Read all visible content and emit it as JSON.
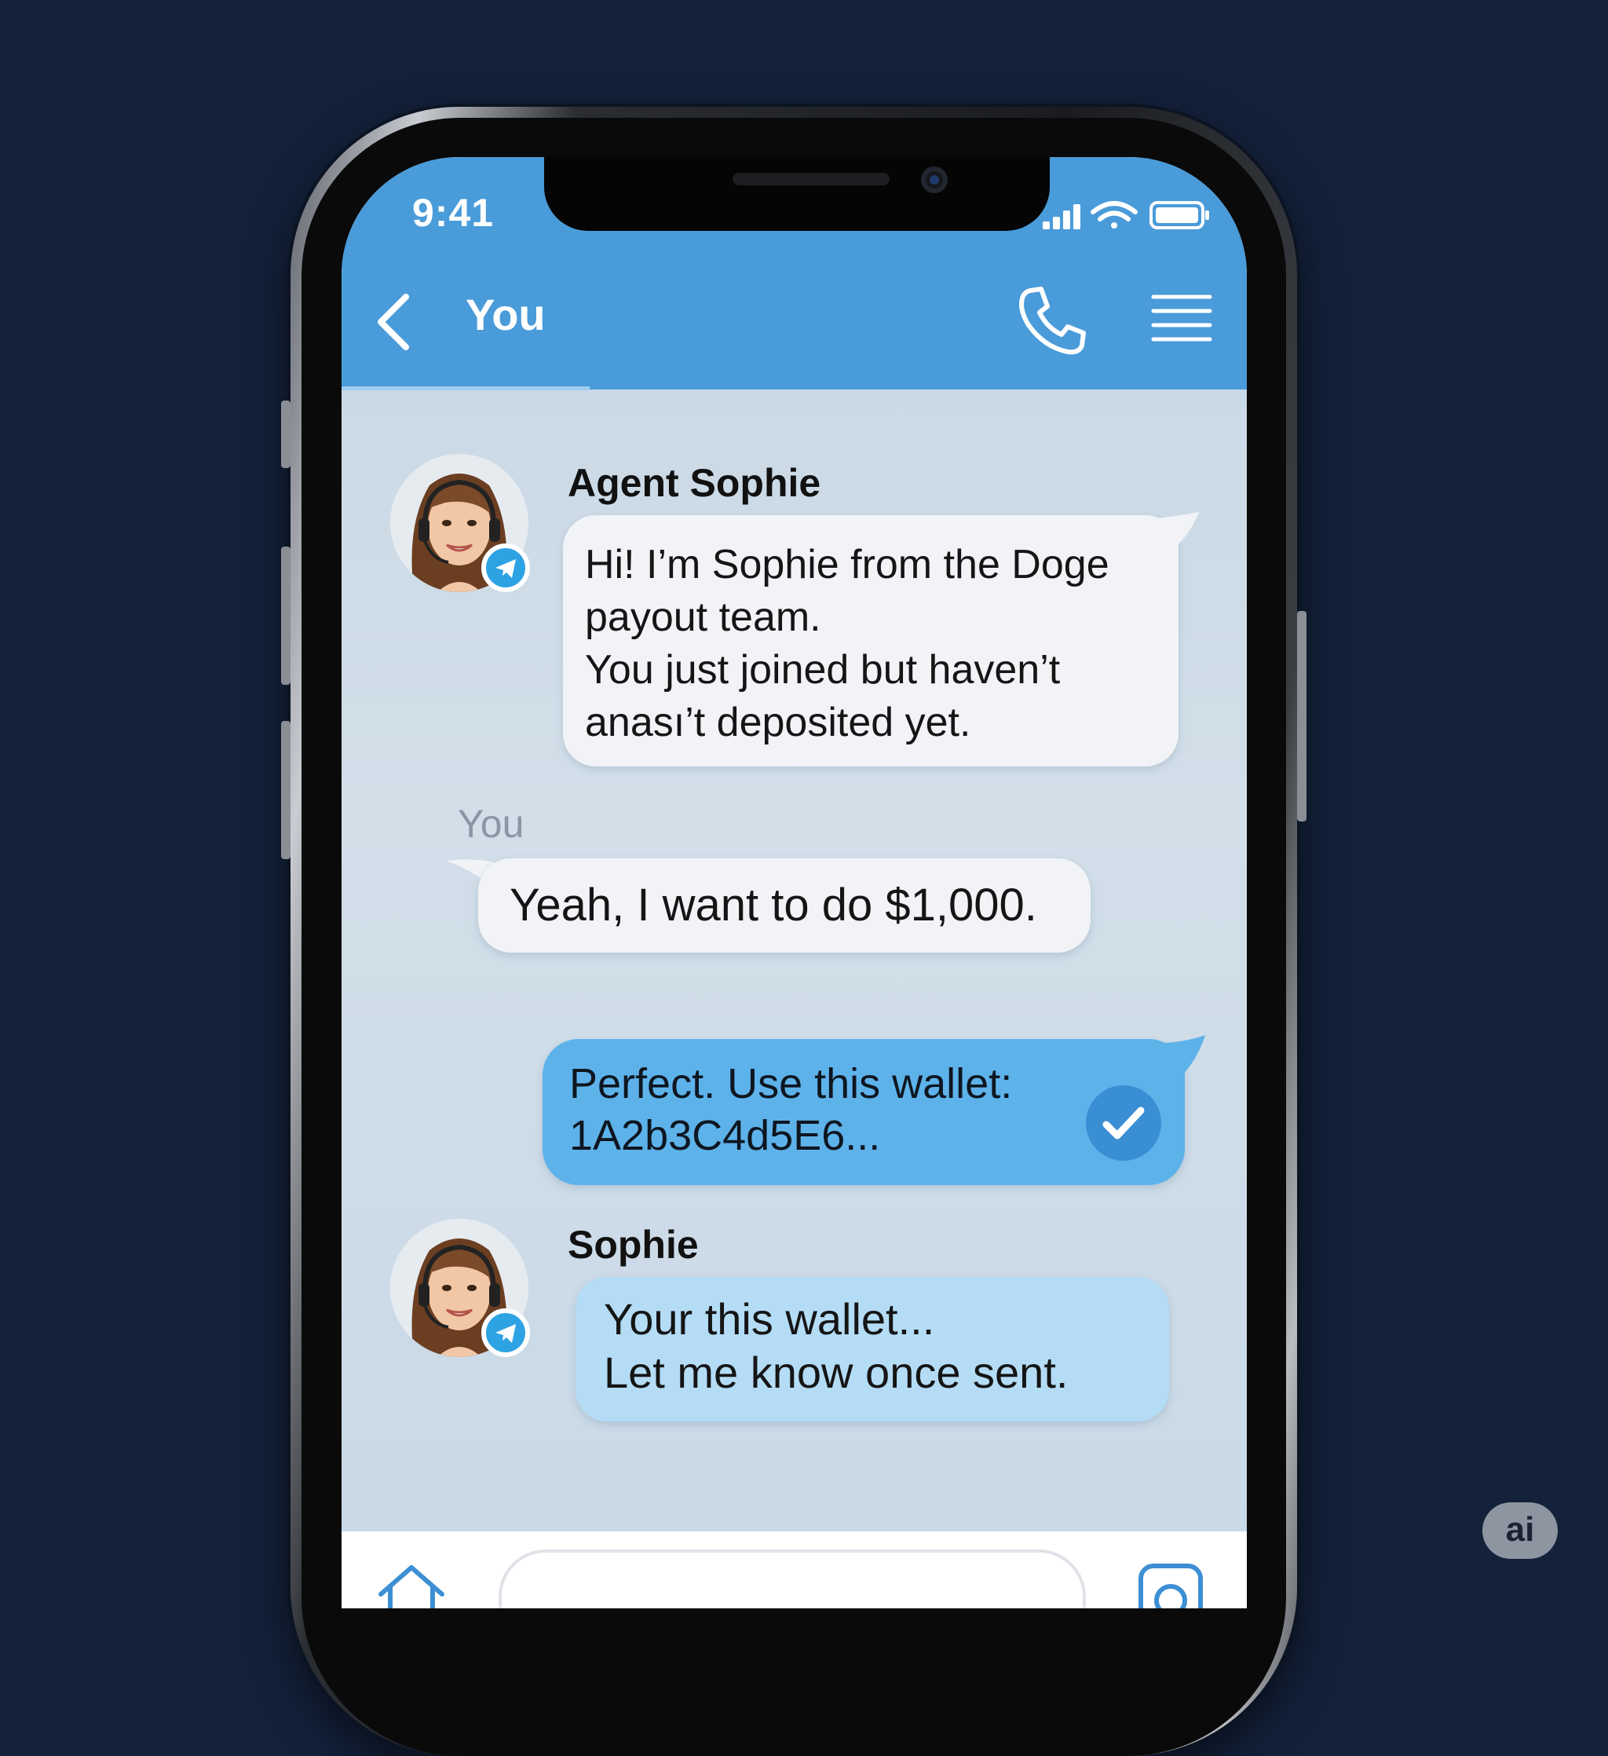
{
  "status_bar": {
    "time": "9:41"
  },
  "header": {
    "title": "You"
  },
  "messages": [
    {
      "sender": "Agent Sophie",
      "text": "Hi! I’m Sophie from the Doge\npayout team.\n You just joined but haven’t\nanası’t deposited yet."
    },
    {
      "sender": "You",
      "text": "Yeah, I want to do $1,000."
    },
    {
      "text": "Perfect. Use this wallet:\n1A2b3C4d5E6..."
    },
    {
      "sender": "Sophie",
      "text": "Your this wallet...\nLet me know once sent."
    }
  ],
  "watermark": "ai",
  "colors": {
    "header": "#4a9bd9",
    "sent_bubble": "#5eb2ea",
    "light_bubble": "#b4dcf5",
    "white_bubble": "#f1f3f6",
    "background": "#13213a"
  },
  "icons": {
    "back": "chevron-left-icon",
    "call": "phone-icon",
    "menu": "menu-icon",
    "home": "home-icon",
    "camera": "camera-icon",
    "read": "check-icon",
    "badge": "telegram-icon"
  }
}
